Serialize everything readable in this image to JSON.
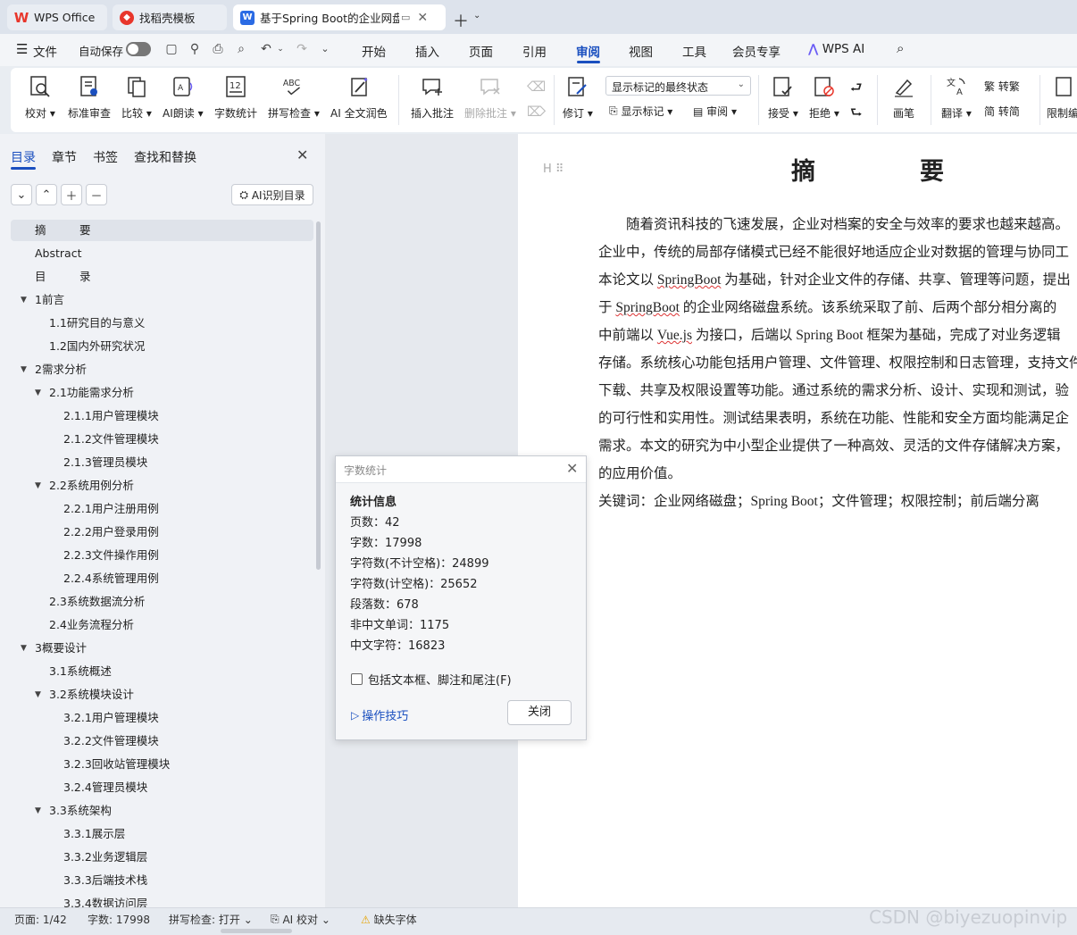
{
  "tabs": [
    {
      "label": "WPS Office",
      "icon": "wps-logo-icon"
    },
    {
      "label": "找稻壳模板",
      "icon": "docer-icon"
    },
    {
      "label": "基于Spring Boot的企业网盘",
      "icon": "word-doc-icon",
      "icon_text": "W"
    }
  ],
  "menubar": {
    "file": "文件",
    "autosave": "自动保存",
    "items": [
      "开始",
      "插入",
      "页面",
      "引用",
      "审阅",
      "视图",
      "工具",
      "会员专享"
    ],
    "active": "审阅",
    "wps_ai": "WPS AI"
  },
  "ribbon": {
    "proofread": "校对",
    "standard_review": "标准审查",
    "compare": "比较",
    "ai_read": "AI朗读",
    "word_count": "字数统计",
    "spell_check": "拼写检查",
    "ai_polish": "AI 全文润色",
    "insert_comment": "插入批注",
    "delete_comment": "删除批注",
    "markup_select": "显示标记的最终状态",
    "track_changes": "修订",
    "show_markup": "显示标记",
    "review": "审阅",
    "accept": "接受",
    "reject": "拒绝",
    "pen": "画笔",
    "translate": "翻译",
    "to_traditional": "转繁",
    "to_simplified": "转简",
    "restrict": "限制编"
  },
  "nav": {
    "tabs": [
      "目录",
      "章节",
      "书签",
      "查找和替换"
    ],
    "ai_toc": "AI识别目录",
    "toc": [
      {
        "label": "摘　　　要",
        "level": 1,
        "caret": false,
        "selected": true
      },
      {
        "label": "Abstract",
        "level": 1,
        "caret": false
      },
      {
        "label": "目　　　录",
        "level": 1,
        "caret": false
      },
      {
        "label": "1前言",
        "level": 1,
        "caret": true
      },
      {
        "label": "1.1研究目的与意义",
        "level": 2,
        "caret": false
      },
      {
        "label": "1.2国内外研究状况",
        "level": 2,
        "caret": false
      },
      {
        "label": "2需求分析",
        "level": 1,
        "caret": true
      },
      {
        "label": "2.1功能需求分析",
        "level": 2,
        "caret": true
      },
      {
        "label": "2.1.1用户管理模块",
        "level": 3,
        "caret": false
      },
      {
        "label": "2.1.2文件管理模块",
        "level": 3,
        "caret": false
      },
      {
        "label": "2.1.3管理员模块",
        "level": 3,
        "caret": false
      },
      {
        "label": "2.2系统用例分析",
        "level": 2,
        "caret": true
      },
      {
        "label": "2.2.1用户注册用例",
        "level": 3,
        "caret": false
      },
      {
        "label": "2.2.2用户登录用例",
        "level": 3,
        "caret": false
      },
      {
        "label": "2.2.3文件操作用例",
        "level": 3,
        "caret": false
      },
      {
        "label": "2.2.4系统管理用例",
        "level": 3,
        "caret": false
      },
      {
        "label": "2.3系统数据流分析",
        "level": 2,
        "caret": false
      },
      {
        "label": "2.4业务流程分析",
        "level": 2,
        "caret": false
      },
      {
        "label": "3概要设计",
        "level": 1,
        "caret": true
      },
      {
        "label": "3.1系统概述",
        "level": 2,
        "caret": false
      },
      {
        "label": "3.2系统模块设计",
        "level": 2,
        "caret": true
      },
      {
        "label": "3.2.1用户管理模块",
        "level": 3,
        "caret": false
      },
      {
        "label": "3.2.2文件管理模块",
        "level": 3,
        "caret": false
      },
      {
        "label": "3.2.3回收站管理模块",
        "level": 3,
        "caret": false
      },
      {
        "label": "3.2.4管理员模块",
        "level": 3,
        "caret": false
      },
      {
        "label": "3.3系统架构",
        "level": 2,
        "caret": true
      },
      {
        "label": "3.3.1展示层",
        "level": 3,
        "caret": false
      },
      {
        "label": "3.3.2业务逻辑层",
        "level": 3,
        "caret": false
      },
      {
        "label": "3.3.3后端技术栈",
        "level": 3,
        "caret": false
      },
      {
        "label": "3.3.4数据访问层",
        "level": 3,
        "caret": false
      }
    ]
  },
  "document": {
    "title_a": "摘",
    "title_b": "要",
    "lines": [
      [
        {
          "t": "　　随着资讯科技的飞速发展，企业对档案的安全与效率的要求也越来越高。"
        }
      ],
      [
        {
          "t": "企业中，传统的局部存储模式已经不能很好地适应企业对数据的管理与协同工"
        }
      ],
      [
        {
          "t": "本论文以 "
        },
        {
          "t": "SpringBoot",
          "sp": true
        },
        {
          "t": " 为基础，针对企业文件的存储、共享、管理等问题，提出"
        }
      ],
      [
        {
          "t": "于 "
        },
        {
          "t": "SpringBoot",
          "sp": true
        },
        {
          "t": " 的企业网络磁盘系统。该系统采取了前、后两个部分相分离的"
        }
      ],
      [
        {
          "t": "中前端以 "
        },
        {
          "t": "Vue.js",
          "sp": true
        },
        {
          "t": " 为接口，后端以 Spring Boot 框架为基础，完成了对业务逻辑"
        }
      ],
      [
        {
          "t": "存储。系统核心功能包括用户管理、文件管理、权限控制和日志管理，支持文件"
        }
      ],
      [
        {
          "t": "下载、共享及权限设置等功能。通过系统的需求分析、设计、实现和测试，验"
        }
      ],
      [
        {
          "t": "的可行性和实用性。测试结果表明，系统在功能、性能和安全方面均能满足企"
        }
      ],
      [
        {
          "t": "需求。本文的研究为中小型企业提供了一种高效、灵活的文件存储解决方案，"
        }
      ],
      [
        {
          "t": "的应用价值。"
        }
      ],
      [
        {
          "t": "关键词：企业网络磁盘；Spring Boot；文件管理；权限控制；前后端分离"
        }
      ]
    ]
  },
  "dialog": {
    "title": "字数统计",
    "heading": "统计信息",
    "stats": [
      "页数：42",
      "字数：17998",
      "字符数(不计空格)：24899",
      "字符数(计空格)：25652",
      "段落数：678",
      "非中文单词：1175",
      "中文字符：16823"
    ],
    "checkbox_label": "包括文本框、脚注和尾注(F)",
    "checkbox_checked": false,
    "tips": "操作技巧",
    "close_button": "关闭"
  },
  "statusbar": {
    "page": "页面: 1/42",
    "words": "字数: 17998",
    "spell": "拼写检查: 打开",
    "ai_proof": "AI 校对",
    "missing_font": "缺失字体"
  },
  "watermark": "CSDN @biyezuopinvip",
  "colors": {
    "accent": "#1a4fbf",
    "wps_red": "#e8362b",
    "word_blue": "#2b6be4"
  }
}
